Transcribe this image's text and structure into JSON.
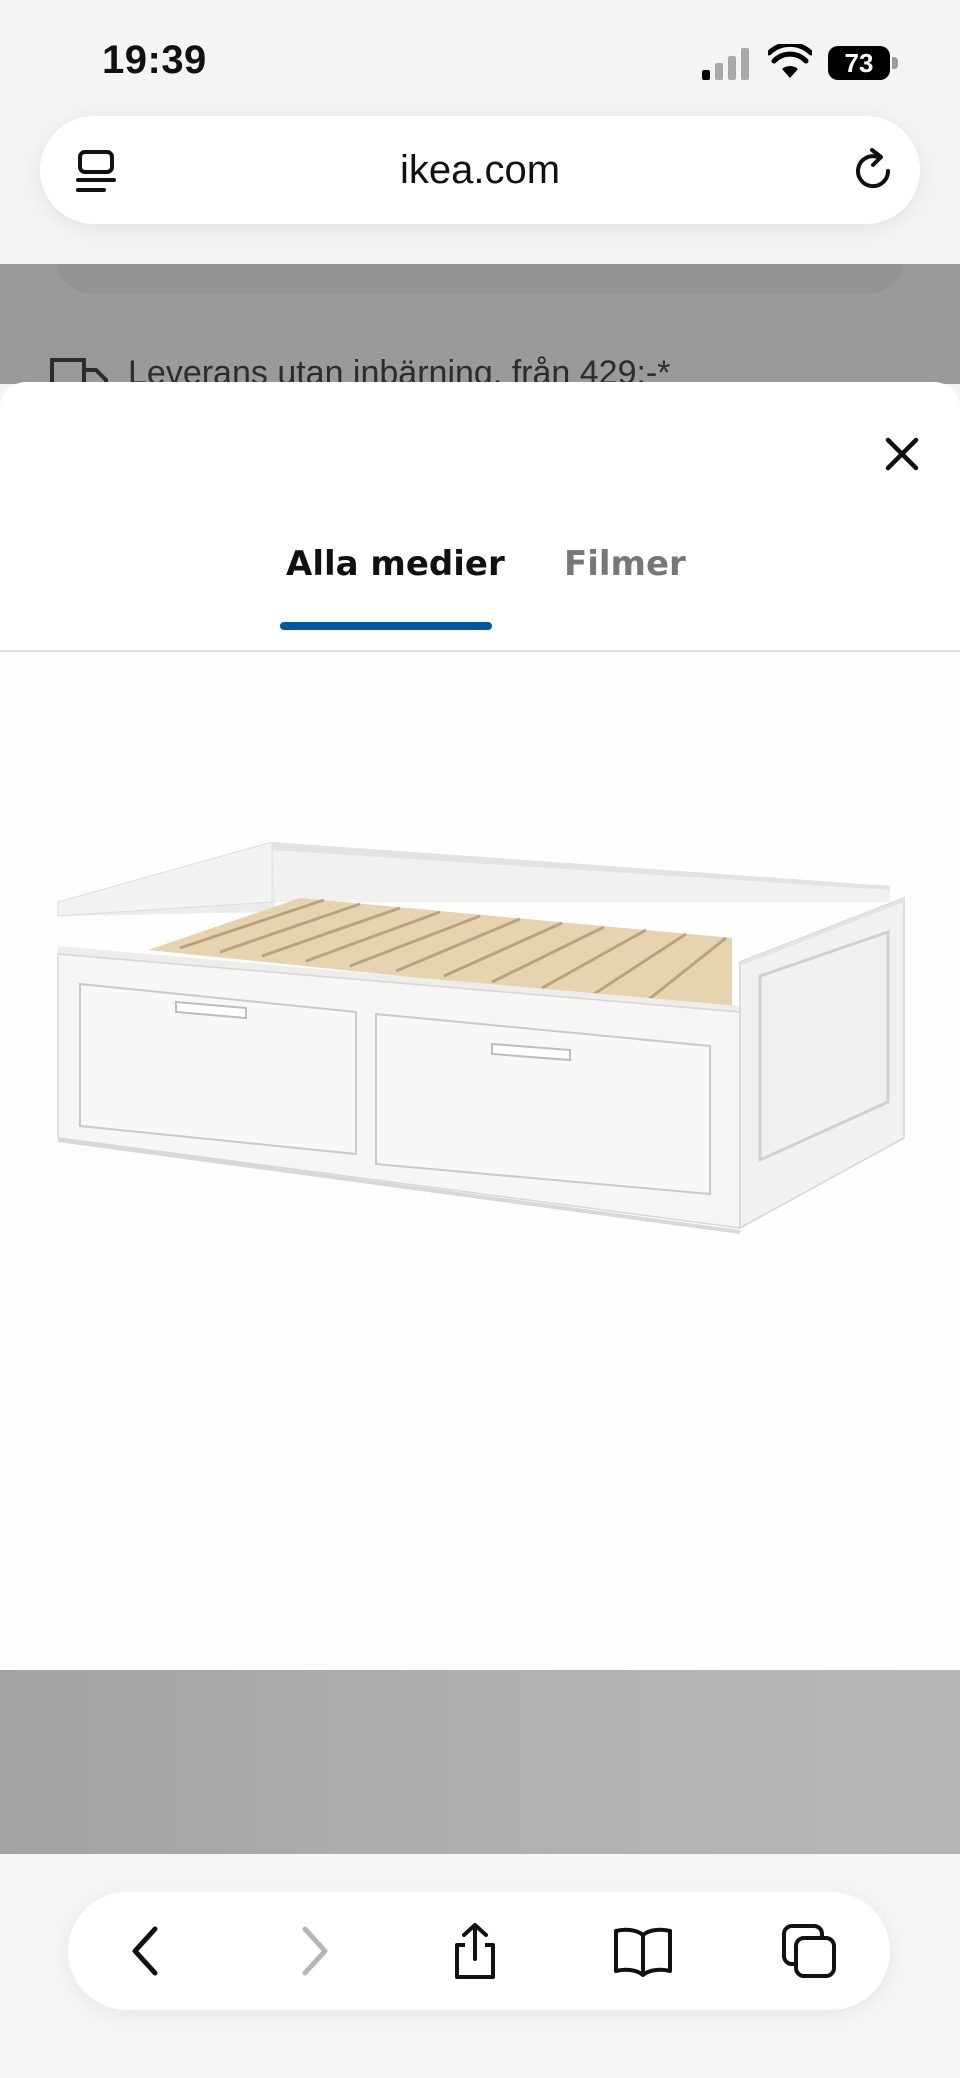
{
  "status_bar": {
    "time": "19:39",
    "battery": "73"
  },
  "browser": {
    "url": "ikea.com"
  },
  "background_page": {
    "delivery_text": "Leverans utan inbärning, från 429:-*"
  },
  "media_modal": {
    "tabs": [
      {
        "label": "Alla medier",
        "selected": true
      },
      {
        "label": "Filmer",
        "selected": false
      }
    ],
    "accent_color": "#0058a3",
    "image": "daybed-with-two-drawers"
  },
  "toolbar": {
    "icons": [
      "back-icon",
      "forward-icon",
      "share-icon",
      "bookmarks-icon",
      "tabs-icon"
    ]
  }
}
